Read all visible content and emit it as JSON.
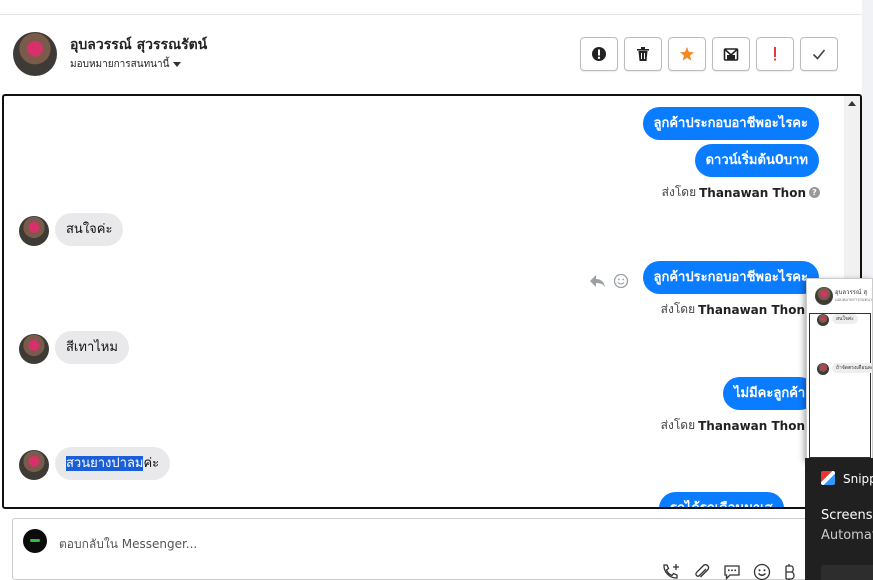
{
  "header": {
    "name": "อุบลวรรณ์ สุวรรณรัตน์",
    "assign_label": "มอบหมายการสนทนานี้",
    "actions": [
      {
        "name": "exclamation-circle-icon"
      },
      {
        "name": "trash-icon"
      },
      {
        "name": "star-icon"
      },
      {
        "name": "mark-unread-icon"
      },
      {
        "name": "exclamation-icon"
      },
      {
        "name": "check-icon"
      }
    ],
    "colors": {
      "star": "#f08a24",
      "exclamation": "#e03a3a"
    }
  },
  "thread": {
    "messages": [
      {
        "side": "out",
        "text": "ลูกค้าประกอบอาชีพอะไรคะ"
      },
      {
        "side": "out",
        "text": "ดาวน์เริ่มต้น0บาท"
      },
      {
        "side": "meta",
        "prefix": "ส่งโดย",
        "sender": "Thanawan Thon"
      },
      {
        "side": "in",
        "text": "สนใจค่ะ"
      },
      {
        "side": "out",
        "text": "ลูกค้าประกอบอาชีพอะไรคะ"
      },
      {
        "side": "meta",
        "prefix": "ส่งโดย",
        "sender": "Thanawan Thon"
      },
      {
        "side": "in",
        "text": "สีเทาไหม"
      },
      {
        "side": "out",
        "text": "ไม่มีคะลูกค้า"
      },
      {
        "side": "meta",
        "prefix": "ส่งโดย",
        "sender": "Thanawan Thon"
      },
      {
        "side": "in",
        "text_highlight": "สวนยางปาลม",
        "text_rest": "ค่ะ"
      },
      {
        "side": "out",
        "text": "รถได้รถเดือนมาเส"
      }
    ],
    "accent_color": "#0a7cff"
  },
  "reply": {
    "placeholder": "ตอบกลับใน Messenger...",
    "tools": [
      "call-add-icon",
      "paperclip-icon",
      "saved-reply-icon",
      "emoji-icon",
      "baht-icon"
    ]
  },
  "overlay": {
    "title": "อุบลวรรณ์ สุ",
    "subtitle": "มอบหมายการสนทนา",
    "msg1": "สนใจค่ะ",
    "msg2": "ถ้าจัดตรงเดือนละ"
  },
  "snip": {
    "title": "Snipp",
    "line1": "Screensh",
    "line2": "Automat"
  }
}
